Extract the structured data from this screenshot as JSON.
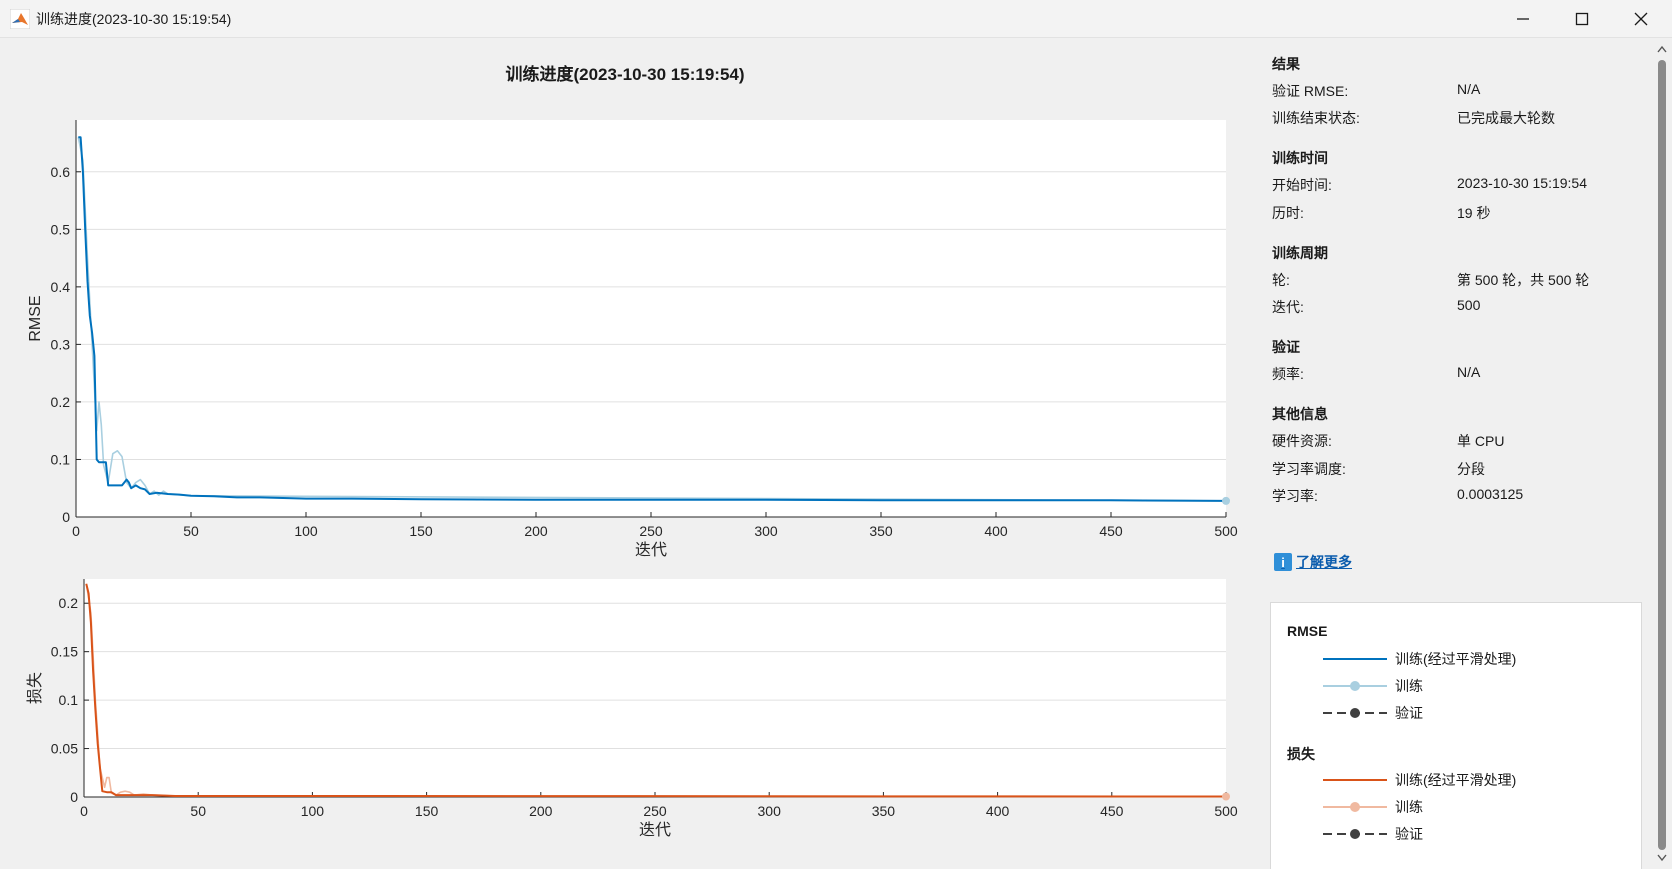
{
  "window": {
    "title": "训练进度(2023-10-30 15:19:54)",
    "app_icon": "matlab-icon",
    "controls": [
      "minimize-icon",
      "maximize-icon",
      "close-icon"
    ]
  },
  "figure_title": "训练进度(2023-10-30 15:19:54)",
  "colors": {
    "rmse_smoothed": "#0072bd",
    "rmse_raw": "#a9cfe0",
    "loss_smoothed": "#d95319",
    "loss_raw": "#f0b9a0",
    "validation": "#404040",
    "grid": "#e0e0e0"
  },
  "chart_data": [
    {
      "type": "line",
      "ylabel": "RMSE",
      "xlabel": "迭代",
      "xlim": [
        0,
        500
      ],
      "ylim": [
        0,
        0.69
      ],
      "xticks": [
        "0",
        "50",
        "100",
        "150",
        "200",
        "250",
        "300",
        "350",
        "400",
        "450",
        "500"
      ],
      "yticks": [
        "0",
        "0.1",
        "0.2",
        "0.3",
        "0.4",
        "0.5",
        "0.6"
      ],
      "grid": true,
      "series": [
        {
          "name": "训练(经过平滑处理)",
          "points": [
            [
              1,
              0.66
            ],
            [
              2,
              0.66
            ],
            [
              3,
              0.6
            ],
            [
              4,
              0.5
            ],
            [
              5,
              0.41
            ],
            [
              6,
              0.35
            ],
            [
              7,
              0.32
            ],
            [
              8,
              0.28
            ],
            [
              9,
              0.1
            ],
            [
              10,
              0.095
            ],
            [
              11,
              0.095
            ],
            [
              12,
              0.095
            ],
            [
              13,
              0.095
            ],
            [
              14,
              0.055
            ],
            [
              16,
              0.055
            ],
            [
              18,
              0.055
            ],
            [
              20,
              0.055
            ],
            [
              22,
              0.065
            ],
            [
              23,
              0.06
            ],
            [
              24,
              0.05
            ],
            [
              26,
              0.055
            ],
            [
              28,
              0.05
            ],
            [
              30,
              0.048
            ],
            [
              32,
              0.04
            ],
            [
              35,
              0.042
            ],
            [
              40,
              0.04
            ],
            [
              45,
              0.039
            ],
            [
              50,
              0.037
            ],
            [
              60,
              0.036
            ],
            [
              70,
              0.034
            ],
            [
              80,
              0.034
            ],
            [
              90,
              0.033
            ],
            [
              100,
              0.032
            ],
            [
              120,
              0.032
            ],
            [
              150,
              0.031
            ],
            [
              200,
              0.03
            ],
            [
              250,
              0.03
            ],
            [
              300,
              0.03
            ],
            [
              350,
              0.029
            ],
            [
              400,
              0.029
            ],
            [
              450,
              0.029
            ],
            [
              500,
              0.028
            ]
          ]
        },
        {
          "name": "训练",
          "points": [
            [
              1,
              0.66
            ],
            [
              3,
              0.62
            ],
            [
              5,
              0.45
            ],
            [
              7,
              0.3
            ],
            [
              9,
              0.15
            ],
            [
              10,
              0.2
            ],
            [
              11,
              0.16
            ],
            [
              12,
              0.09
            ],
            [
              14,
              0.06
            ],
            [
              16,
              0.11
            ],
            [
              18,
              0.115
            ],
            [
              20,
              0.105
            ],
            [
              22,
              0.06
            ],
            [
              24,
              0.05
            ],
            [
              26,
              0.06
            ],
            [
              28,
              0.065
            ],
            [
              30,
              0.055
            ],
            [
              32,
              0.04
            ],
            [
              34,
              0.045
            ],
            [
              36,
              0.038
            ],
            [
              38,
              0.045
            ],
            [
              40,
              0.04
            ],
            [
              50,
              0.037
            ],
            [
              500,
              0.028
            ]
          ]
        }
      ]
    },
    {
      "type": "line",
      "ylabel": "损失",
      "xlabel": "迭代",
      "xlim": [
        0,
        500
      ],
      "ylim": [
        0,
        0.225
      ],
      "xticks": [
        "0",
        "50",
        "100",
        "150",
        "200",
        "250",
        "300",
        "350",
        "400",
        "450",
        "500"
      ],
      "yticks": [
        "0",
        "0.05",
        "0.1",
        "0.15",
        "0.2"
      ],
      "grid": true,
      "series": [
        {
          "name": "训练(经过平滑处理)",
          "points": [
            [
              1,
              0.22
            ],
            [
              2,
              0.21
            ],
            [
              3,
              0.18
            ],
            [
              4,
              0.13
            ],
            [
              5,
              0.09
            ],
            [
              6,
              0.055
            ],
            [
              7,
              0.03
            ],
            [
              8,
              0.006
            ],
            [
              10,
              0.005
            ],
            [
              12,
              0.005
            ],
            [
              14,
              0.002
            ],
            [
              20,
              0.002
            ],
            [
              30,
              0.002
            ],
            [
              40,
              0.001
            ],
            [
              60,
              0.001
            ],
            [
              100,
              0.001
            ],
            [
              500,
              0.0005
            ]
          ]
        },
        {
          "name": "训练",
          "points": [
            [
              1,
              0.22
            ],
            [
              3,
              0.19
            ],
            [
              5,
              0.1
            ],
            [
              7,
              0.03
            ],
            [
              9,
              0.01
            ],
            [
              10,
              0.02
            ],
            [
              11,
              0.02
            ],
            [
              12,
              0.004
            ],
            [
              14,
              0.002
            ],
            [
              16,
              0.005
            ],
            [
              18,
              0.006
            ],
            [
              20,
              0.005
            ],
            [
              22,
              0.002
            ],
            [
              26,
              0.003
            ],
            [
              30,
              0.002
            ],
            [
              40,
              0.001
            ],
            [
              500,
              0.0005
            ]
          ]
        }
      ]
    }
  ],
  "results": {
    "title": "结果",
    "rows": [
      {
        "label": "验证 RMSE:",
        "value": "N/A"
      },
      {
        "label": "训练结束状态:",
        "value": "已完成最大轮数"
      }
    ]
  },
  "training_time": {
    "title": "训练时间",
    "rows": [
      {
        "label": "开始时间:",
        "value": "2023-10-30 15:19:54"
      },
      {
        "label": "历时:",
        "value": "19 秒"
      }
    ]
  },
  "training_cycle": {
    "title": "训练周期",
    "rows": [
      {
        "label": "轮:",
        "value": "第 500 轮，共 500 轮"
      },
      {
        "label": "迭代:",
        "value": "500"
      }
    ]
  },
  "validation": {
    "title": "验证",
    "rows": [
      {
        "label": "频率:",
        "value": "N/A"
      }
    ]
  },
  "other_info": {
    "title": "其他信息",
    "rows": [
      {
        "label": "硬件资源:",
        "value": "单 CPU"
      },
      {
        "label": "学习率调度:",
        "value": "分段"
      },
      {
        "label": "学习率:",
        "value": "0.0003125"
      }
    ]
  },
  "learn_more": {
    "icon": "info-icon",
    "label": "了解更多"
  },
  "legend": {
    "rmse": {
      "title": "RMSE",
      "items": [
        "训练(经过平滑处理)",
        "训练",
        "验证"
      ]
    },
    "loss": {
      "title": "损失",
      "items": [
        "训练(经过平滑处理)",
        "训练",
        "验证"
      ]
    }
  }
}
